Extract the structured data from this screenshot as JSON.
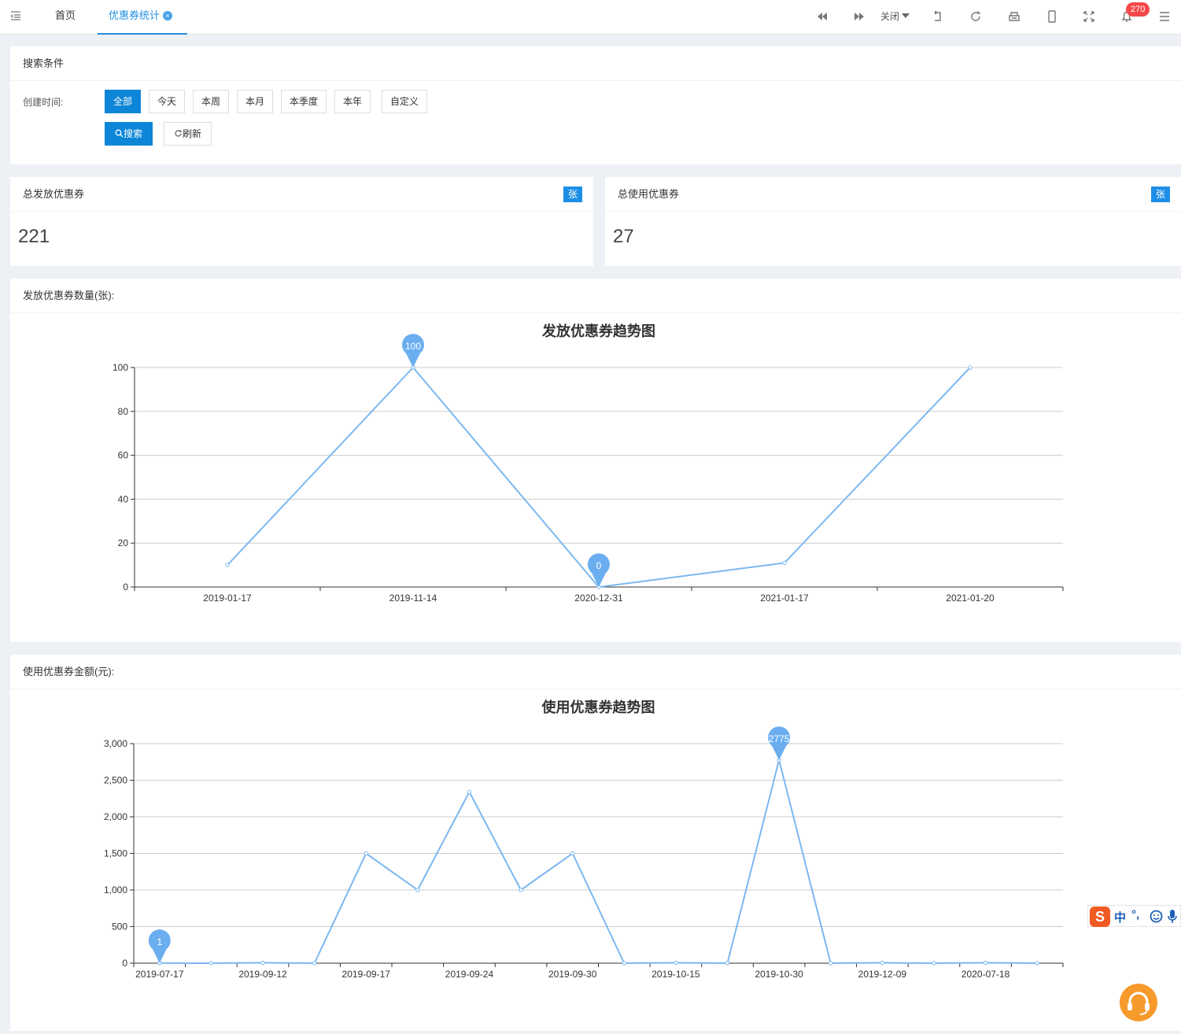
{
  "topbar": {
    "tabs": [
      {
        "label": "首页"
      },
      {
        "label": "优惠券统计",
        "close": "×"
      }
    ],
    "close_menu_label": "关闭",
    "notification_count": "270",
    "icons": [
      "menu-icon",
      "prev-icon",
      "next-icon",
      "return-icon",
      "refresh-icon",
      "print-icon",
      "mobile-icon",
      "fullscreen-icon",
      "bell-icon",
      "more-icon"
    ]
  },
  "search": {
    "title": "搜索条件",
    "created_time_label": "创建时间:",
    "filters": [
      "全部",
      "今天",
      "本周",
      "本月",
      "本季度",
      "本年",
      "自定义"
    ],
    "active_filter": "全部",
    "search_label": "搜索",
    "refresh_label": "刷新"
  },
  "stats": [
    {
      "title": "总发放优惠券",
      "unit": "张",
      "value": "221"
    },
    {
      "title": "总使用优惠券",
      "unit": "张",
      "value": "27"
    }
  ],
  "chart_panels": [
    {
      "header": "发放优惠券数量(张):"
    },
    {
      "header": "使用优惠券金额(元):"
    }
  ],
  "chart_data": [
    {
      "type": "line",
      "title": "发放优惠券趋势图",
      "categories": [
        "2019-01-17",
        "2019-11-14",
        "2020-12-31",
        "2021-01-17",
        "2021-01-20"
      ],
      "values": [
        10,
        100,
        0,
        11,
        100
      ],
      "ylim": [
        0,
        100
      ],
      "yticks": [
        "0",
        "20",
        "40",
        "60",
        "80",
        "100"
      ],
      "grid": true,
      "markers": [
        {
          "label": "100",
          "index": 1
        },
        {
          "label": "0",
          "index": 2
        }
      ],
      "color": "#7cb8f0"
    },
    {
      "type": "line",
      "title": "使用优惠券趋势图",
      "categories": [
        "2019-07-17",
        "",
        "2019-09-12",
        "",
        "2019-09-17",
        "",
        "2019-09-24",
        "",
        "2019-09-30",
        "",
        "2019-10-15",
        "",
        "2019-10-30",
        "",
        "2019-12-09",
        "",
        "2020-07-18",
        ""
      ],
      "values": [
        1,
        0,
        5,
        0,
        1500,
        1000,
        2340,
        1000,
        1500,
        0,
        5,
        0,
        2775,
        0,
        5,
        0,
        5,
        0
      ],
      "ylim": [
        0,
        3000
      ],
      "yticks": [
        "0",
        "500",
        "1,000",
        "1,500",
        "2,000",
        "2,500",
        "3,000"
      ],
      "grid": true,
      "markers": [
        {
          "label": "1",
          "index": 0
        },
        {
          "label": "2775",
          "index": 12
        }
      ],
      "color": "#7cb8f0"
    }
  ],
  "ime": {
    "char": "中",
    "punct": "°,",
    "logo": "S"
  }
}
